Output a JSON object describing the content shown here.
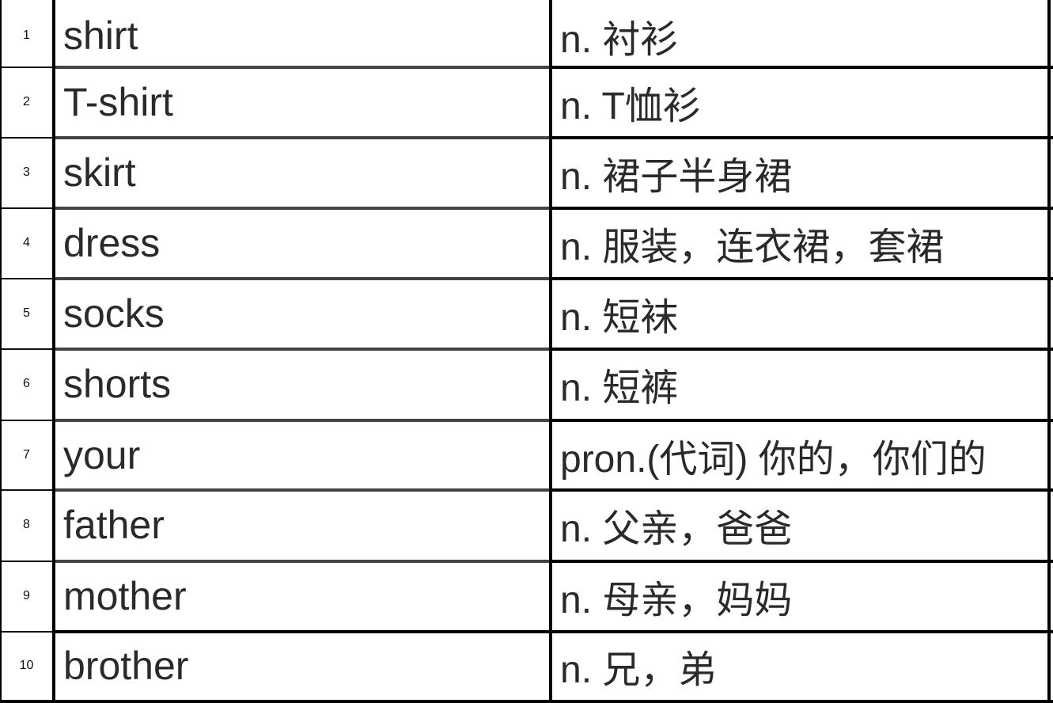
{
  "table": {
    "rows": [
      {
        "num": "1",
        "word": "shirt",
        "definition": "n. 衬衫"
      },
      {
        "num": "2",
        "word": "T-shirt",
        "definition": "n. T恤衫"
      },
      {
        "num": "3",
        "word": "skirt",
        "definition": "n. 裙子半身裙"
      },
      {
        "num": "4",
        "word": "dress",
        "definition": "n. 服装，连衣裙，套裙"
      },
      {
        "num": "5",
        "word": "socks",
        "definition": "n. 短袜"
      },
      {
        "num": "6",
        "word": "shorts",
        "definition": "n. 短裤"
      },
      {
        "num": "7",
        "word": "your",
        "definition": "pron.(代词) 你的，你们的"
      },
      {
        "num": "8",
        "word": "father",
        "definition": "n. 父亲，爸爸"
      },
      {
        "num": "9",
        "word": "mother",
        "definition": "n. 母亲，妈妈"
      },
      {
        "num": "10",
        "word": "brother",
        "definition": "n. 兄，弟"
      }
    ]
  }
}
